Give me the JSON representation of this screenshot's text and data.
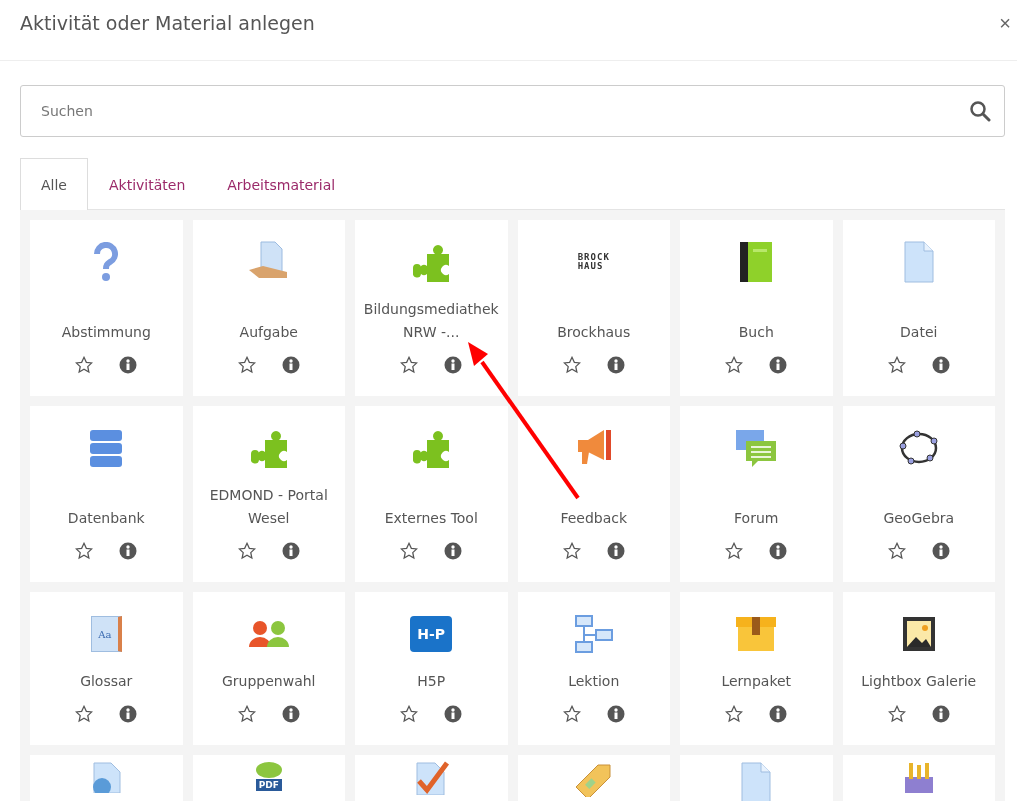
{
  "dialog": {
    "title": "Aktivität oder Material anlegen",
    "close": "×"
  },
  "search": {
    "placeholder": "Suchen"
  },
  "tabs": [
    {
      "label": "Alle",
      "selected": true
    },
    {
      "label": "Aktivitäten",
      "selected": false
    },
    {
      "label": "Arbeitsmaterial",
      "selected": false
    }
  ],
  "rows": [
    {
      "items": [
        {
          "name": "Abstimmung",
          "kind": "question"
        },
        {
          "name": "Aufgabe",
          "kind": "assignment"
        },
        {
          "name": "Bildungsmediathek NRW -...",
          "kind": "puzzle"
        },
        {
          "name": "Brockhaus",
          "kind": "wordmark",
          "logo_text": [
            "BROCK",
            "HAUS"
          ]
        },
        {
          "name": "Buch",
          "kind": "book"
        },
        {
          "name": "Datei",
          "kind": "file"
        }
      ]
    },
    {
      "items": [
        {
          "name": "Datenbank",
          "kind": "database"
        },
        {
          "name": "EDMOND - Portal Wesel",
          "kind": "puzzle"
        },
        {
          "name": "Externes Tool",
          "kind": "puzzle"
        },
        {
          "name": "Feedback",
          "kind": "megaphone"
        },
        {
          "name": "Forum",
          "kind": "chat"
        },
        {
          "name": "GeoGebra",
          "kind": "ellipse"
        }
      ]
    },
    {
      "items": [
        {
          "name": "Glossar",
          "kind": "glossary",
          "logo_text": [
            "Aa"
          ]
        },
        {
          "name": "Gruppenwahl",
          "kind": "people"
        },
        {
          "name": "H5P",
          "kind": "badge",
          "logo_text": [
            "H-P"
          ]
        },
        {
          "name": "Lektion",
          "kind": "flow"
        },
        {
          "name": "Lernpaket",
          "kind": "box"
        },
        {
          "name": "Lightbox Galerie",
          "kind": "picture"
        }
      ]
    },
    {
      "items": [
        {
          "kind": "globe-file"
        },
        {
          "kind": "pdf-chat",
          "logo_text": [
            "PDF"
          ]
        },
        {
          "kind": "check-file"
        },
        {
          "kind": "tag"
        },
        {
          "kind": "file"
        },
        {
          "kind": "tools"
        }
      ]
    }
  ]
}
